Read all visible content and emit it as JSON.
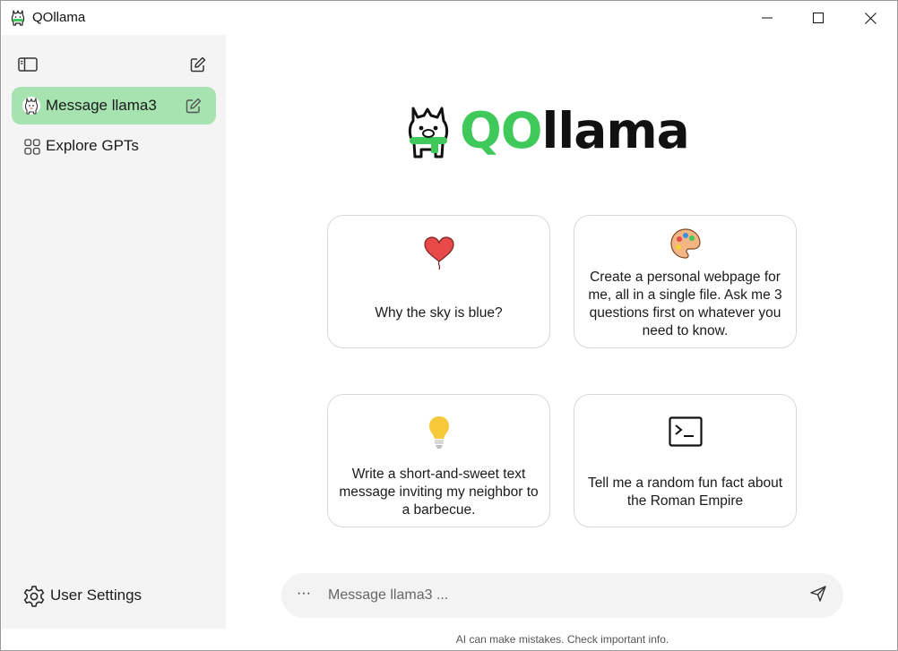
{
  "window": {
    "title": "QOllama",
    "controls": [
      "minimize-icon",
      "maximize-icon",
      "close-icon"
    ]
  },
  "sidebar": {
    "toggle_icon": "sidebar-toggle-icon",
    "new_chat_icon": "new-chat-icon",
    "items": [
      {
        "label": "Message llama3",
        "icon": "llama-avatar-icon",
        "action_icon": "edit-icon",
        "active": true
      },
      {
        "label": "Explore GPTs",
        "icon": "grid-icon",
        "active": false
      }
    ],
    "footer": {
      "label": "User Settings",
      "icon": "gear-icon"
    }
  },
  "main": {
    "logo": {
      "accent": "QO",
      "rest": "llama"
    },
    "suggestions": [
      {
        "icon": "heart-balloon-icon",
        "text": "Why the sky is blue?"
      },
      {
        "icon": "palette-icon",
        "text": "Create a personal webpage for me, all in a single file. Ask me 3 questions first on whatever you need to know."
      },
      {
        "icon": "lightbulb-icon",
        "text": "Write a short-and-sweet text message inviting my neighbor to a barbecue."
      },
      {
        "icon": "terminal-icon",
        "text": "Tell me a random fun fact about the Roman Empire"
      }
    ],
    "composer": {
      "more_label": "···",
      "placeholder": "Message llama3 ...",
      "value": "",
      "send_icon": "send-icon"
    },
    "disclaimer": "AI can make mistakes. Check important info."
  },
  "colors": {
    "accent": "#3ec95a",
    "active_item_bg": "#a6e3b1",
    "sidebar_bg": "#f4f4f4",
    "composer_bg": "#f3f3f3"
  }
}
